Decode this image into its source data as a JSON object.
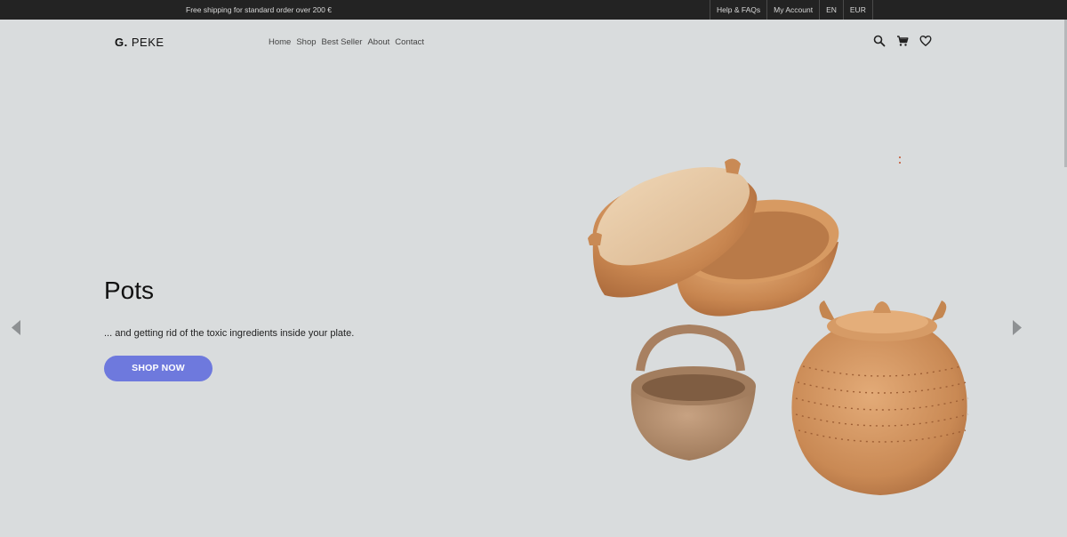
{
  "topbar": {
    "promo": "Free shipping for standard order over 200 €",
    "help": "Help & FAQs",
    "account": "My Account",
    "lang": "EN",
    "currency": "EUR"
  },
  "header": {
    "logo_mark": "G.",
    "logo_text": "PEKE",
    "nav": [
      "Home",
      "Shop",
      "Best Seller",
      "About",
      "Contact"
    ],
    "icons": [
      "search-icon",
      "cart-icon",
      "heart-icon"
    ]
  },
  "hero": {
    "title": "Pots",
    "subtitle": "... and getting rid of the toxic ingredients inside your plate.",
    "cta": "SHOP NOW"
  },
  "colors": {
    "background": "#d9dcdd",
    "topbar": "#232323",
    "accent": "#6e79dd",
    "clay": "#c98a5a"
  }
}
